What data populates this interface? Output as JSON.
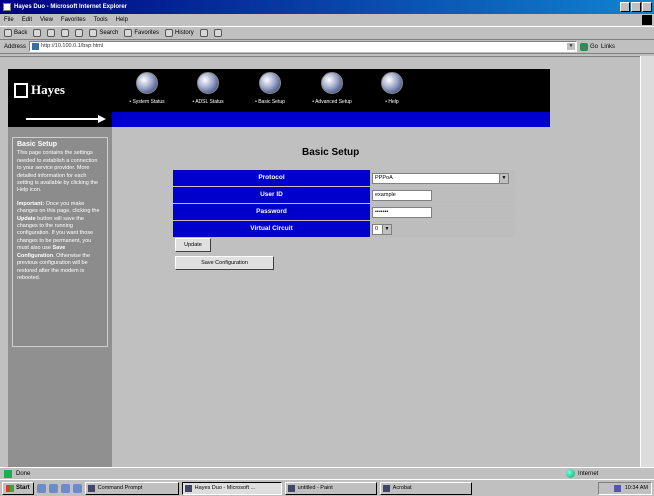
{
  "window": {
    "title": "Hayes Duo - Microsoft Internet Explorer"
  },
  "menu": [
    "File",
    "Edit",
    "View",
    "Favorites",
    "Tools",
    "Help"
  ],
  "toolbar": [
    {
      "label": "Back",
      "icon": "back-icon"
    },
    {
      "label": "",
      "icon": "forward-icon"
    },
    {
      "label": "",
      "icon": "stop-icon"
    },
    {
      "label": "",
      "icon": "refresh-icon"
    },
    {
      "label": "",
      "icon": "home-icon"
    },
    {
      "label": "Search",
      "icon": "search-icon"
    },
    {
      "label": "Favorites",
      "icon": "favorites-icon"
    },
    {
      "label": "History",
      "icon": "history-icon"
    },
    {
      "label": "",
      "icon": "mail-icon"
    },
    {
      "label": "",
      "icon": "print-icon"
    }
  ],
  "address": {
    "label": "Address",
    "url": "http://10.100.0.1/bsp.html",
    "go": "Go",
    "links": "Links"
  },
  "brand": "Hayes",
  "nav": [
    {
      "label": "• System Status",
      "icon": "system-status-icon"
    },
    {
      "label": "• ADSL Status",
      "icon": "adsl-status-icon"
    },
    {
      "label": "• Basic Setup",
      "icon": "basic-setup-icon"
    },
    {
      "label": "• Advanced Setup",
      "icon": "advanced-setup-icon"
    },
    {
      "label": "• Help",
      "icon": "help-icon"
    }
  ],
  "sidebar": {
    "title": "Basic Setup",
    "p1": "This page contains the settings needed to establish a connection to your service provider. More detailed information for each setting is available by clicking the Help icon.",
    "p2_bold": "Important:",
    "p2_a": " Once you make changes on this page, clicking the ",
    "p2_update": "Update",
    "p2_b": " button will save the changes to the running configuration. If you want those changes to be permanent, you must also use ",
    "p2_save": "Save Configuration",
    "p2_c": ". Otherwise the previous configuration will be restored after the modem is rebooted."
  },
  "page": {
    "title": "Basic Setup"
  },
  "form": {
    "protocol_label": "Protocol",
    "protocol_value": "PPPoA",
    "userid_label": "User ID",
    "userid_value": "example",
    "password_label": "Password",
    "password_value": "•••••••",
    "vc_label": "Virtual Circuit",
    "vc_value": "0"
  },
  "buttons": {
    "update": "Update",
    "save": "Save Configuration"
  },
  "status": {
    "text": "Done",
    "zone": "Internet"
  },
  "taskbar": {
    "start": "Start",
    "tasks": [
      "Command Prompt",
      "Hayes Duo - Microsoft ...",
      "untitled - Paint",
      "Acrobat"
    ],
    "clock": "10:34 AM"
  }
}
